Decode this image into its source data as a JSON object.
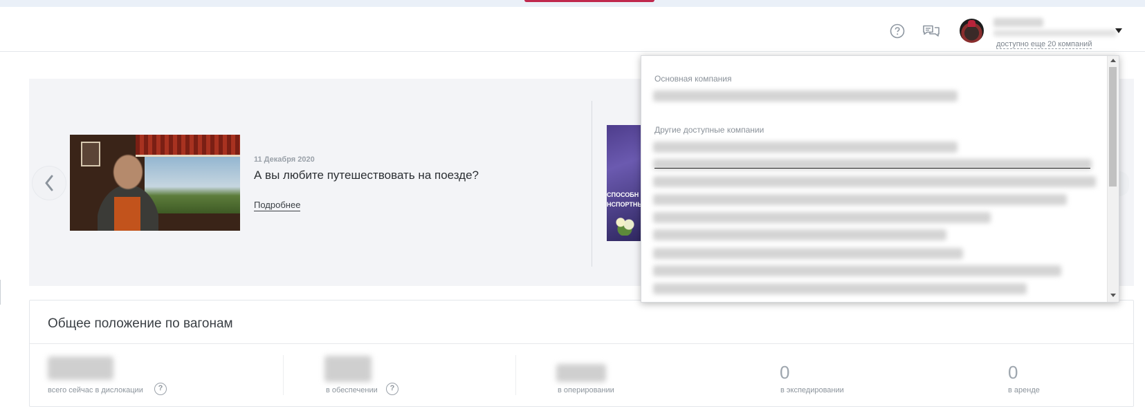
{
  "header": {
    "help_icon": "question-circle-icon",
    "chat_icon": "chat-bubbles-icon",
    "user": {
      "companies_note": "доступно еще 20 компаний"
    }
  },
  "banner": {
    "slides": [
      {
        "date": "11 Декабря 2020",
        "title": "А вы любите путешествовать на поезде?",
        "more_link": "Подробнее"
      },
      {
        "image_text_1": "СПОСОБН",
        "image_text_2": "НСПОРТНЫ"
      }
    ]
  },
  "stats": {
    "title": "Общее положение по вагонам",
    "items": [
      {
        "label": "всего сейчас в дислокации",
        "value": null,
        "has_help": true
      },
      {
        "label": "в обеспечении",
        "value": null,
        "has_help": true
      },
      {
        "label": "в оперировании",
        "value": null,
        "has_help": false
      },
      {
        "label": "в экспедировании",
        "value": "0",
        "has_help": false
      },
      {
        "label": "в аренде",
        "value": "0",
        "has_help": false
      }
    ]
  },
  "company_dropdown": {
    "main_label": "Основная компания",
    "other_label": "Другие доступные компании"
  },
  "colors": {
    "accent_pink": "#c0284d",
    "banner_bg": "#f3f4f7",
    "muted_text": "#9ea6ae"
  }
}
